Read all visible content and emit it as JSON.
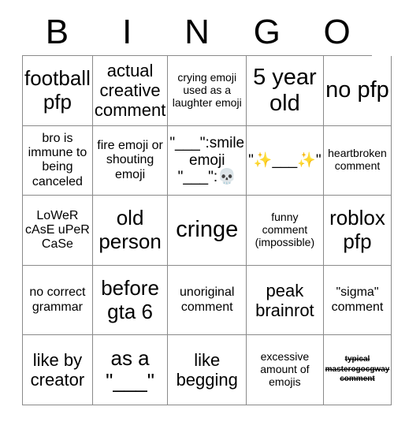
{
  "header": {
    "letters": [
      "B",
      "I",
      "N",
      "G",
      "O"
    ]
  },
  "grid": {
    "rows": [
      [
        {
          "text": "football pfp",
          "size": "fs-xl"
        },
        {
          "text": "actual creative comment",
          "size": "fs-l"
        },
        {
          "text": "crying emoji used as a laughter emoji",
          "size": "fs-xs"
        },
        {
          "text": "5 year old",
          "size": "fs-xxl"
        },
        {
          "text": "no pfp",
          "size": "fs-xxl"
        }
      ],
      [
        {
          "text": "bro is immune to being canceled",
          "size": "fs-s"
        },
        {
          "text": "fire emoji or shouting emoji",
          "size": "fs-s"
        },
        {
          "text": "\"___\":smile emoji \"___\":💀",
          "size": "fs-m"
        },
        {
          "text": "\"✨___✨\"",
          "size": "fs-m"
        },
        {
          "text": "heartbroken comment",
          "size": "fs-xs"
        }
      ],
      [
        {
          "text": "LoWeR cAsE uPeR CaSe",
          "size": "fs-s"
        },
        {
          "text": "old person",
          "size": "fs-xl"
        },
        {
          "text": "cringe",
          "size": "fs-xxl"
        },
        {
          "text": "funny comment (impossible)",
          "size": "fs-xs"
        },
        {
          "text": "roblox pfp",
          "size": "fs-xl"
        }
      ],
      [
        {
          "text": "no correct grammar",
          "size": "fs-s"
        },
        {
          "text": "before gta 6",
          "size": "fs-xl"
        },
        {
          "text": "unoriginal comment",
          "size": "fs-s"
        },
        {
          "text": "peak brainrot",
          "size": "fs-l"
        },
        {
          "text": "\"sigma\" comment",
          "size": "fs-s"
        }
      ],
      [
        {
          "text": "like by creator",
          "size": "fs-l"
        },
        {
          "text": "as a \"___\"",
          "size": "fs-xl"
        },
        {
          "text": "like begging",
          "size": "fs-l"
        },
        {
          "text": "excessive amount of emojis",
          "size": "fs-xs"
        },
        {
          "text": "typical masterogocgway comment",
          "size": "fs-tiny"
        }
      ]
    ]
  },
  "colors": {
    "background": "#ffffff",
    "text": "#000000",
    "grid_line": "#8a8a8a"
  }
}
